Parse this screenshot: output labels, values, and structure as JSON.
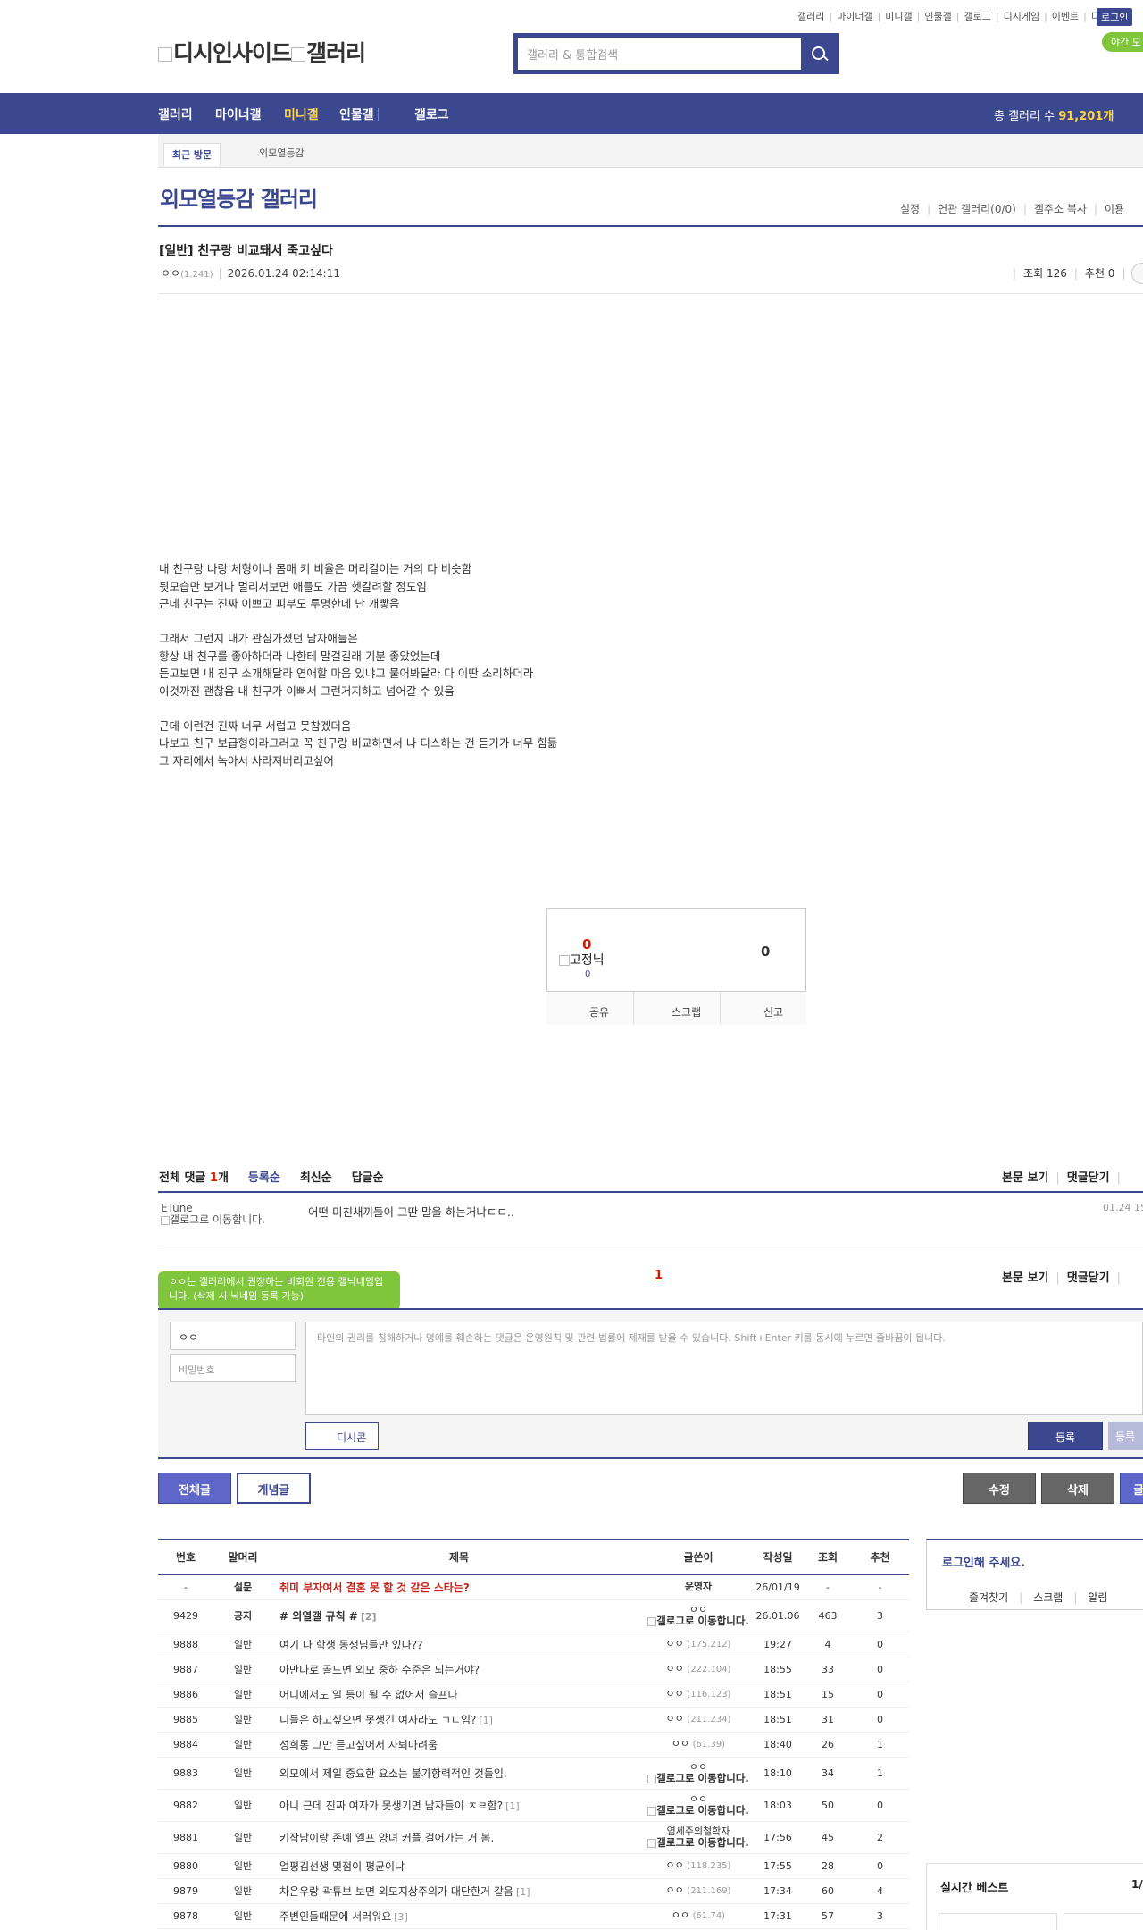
{
  "top_links": [
    "갤러리",
    "마이너갤",
    "미니갤",
    "인물갤",
    "갤로그",
    "디시게임",
    "이벤트",
    "디시콘"
  ],
  "login_label": "로그인",
  "night_mode_label": "야간 모",
  "logo_alt": [
    "디시인사이드",
    "갤러리"
  ],
  "search_placeholder": "갤러리 & 통합검색",
  "nav": [
    "갤러리",
    "마이너갤",
    "미니갤",
    "인물갤",
    "갤로그"
  ],
  "nav_active": "미니갤",
  "total_label": "총 갤러리 수 ",
  "total_count": "91,201개",
  "recent_label": "최근 방문",
  "recent_item": "외모열등감",
  "gallery_title": "외모열등감 갤러리",
  "gallery_menu": [
    "설정",
    "연관 갤러리(0/0)",
    "갤주소 복사",
    "이용"
  ],
  "post": {
    "title": "[일반] 친구랑 비교돼서 죽고싶다",
    "writer": "ㅇㅇ",
    "ip": "(1.241)",
    "date": "2026.01.24 02:14:11",
    "views": "조회 126",
    "recommend": "추천 0",
    "body": [
      "내 친구랑 나랑 체형이나 몸매 키 비율은 머리길이는 거의 다 비슷함",
      "뒷모습만 보거나 멀리서보면 애들도 가끔 헷갈려할 정도임",
      "근데 친구는 진짜 이쁘고 피부도 투명한데 난 개빻음",
      "",
      "그래서 그런지 내가 관심가졌던 남자애들은",
      "항상 내 친구를 좋아하더라 나한테 말걸길래 기분 좋았었는데",
      "듣고보면 내 친구 소개해달라 연애할 마음 있냐고 물어봐달라 다 이딴 소리하더라",
      "이것까진 괜찮음 내 친구가 이뻐서 그런거지하고 넘어갈 수 있음",
      "",
      "근데 이런건 진짜 너무 서럽고 못참겠더음",
      "나보고 친구 보급형이라그러고 꼭 친구랑 비교하면서 나 디스하는 건 듣기가 너무 힘듦",
      "그 자리에서 녹아서 사라져버리고싶어"
    ]
  },
  "vote": {
    "up": "0",
    "fix_alt": "고정닉",
    "fix_count": "0",
    "down": "0",
    "actions": [
      "공유",
      "스크랩",
      "신고"
    ]
  },
  "comments": {
    "total_prefix": "전체 댓글 ",
    "total_num": "1",
    "total_suffix": "개",
    "sort_tabs": [
      "등록순",
      "최신순",
      "답글순"
    ],
    "right_links": [
      "본문 보기",
      "댓글닫기"
    ],
    "items": [
      {
        "nick": "ETune",
        "nick_alt": "갤로그로 이동합니다.",
        "text": "어떤 미친새끼들이 그딴 말을 하는거냐ㄷㄷ..",
        "date": "01.24 15"
      }
    ],
    "page": "1"
  },
  "write": {
    "tooltip": "ㅇㅇ는 갤러리에서 권장하는 비회원 전용 갤닉네임입니다. (삭제 시 닉네임 등록 가능)",
    "nick_value": "ㅇㅇ",
    "password_placeholder": "비밀번호",
    "memo_placeholder": "타인의 권리를 침해하거나 명예를 훼손하는 댓글은 운영원칙 및 관련 법률에 제재를 받을 수 있습니다. Shift+Enter 키를 동시에 누르면 줄바꿈이 됩니다.",
    "dccon": "디시콘",
    "submit": "등록",
    "submit2": "등록"
  },
  "buttons": {
    "all": "전체글",
    "concept": "개념글",
    "edit": "수정",
    "delete": "삭제",
    "write": "글"
  },
  "list_headers": [
    "번호",
    "말머리",
    "제목",
    "글쓴이",
    "작성일",
    "조회",
    "추천"
  ],
  "list_rows": [
    {
      "no": "-",
      "head": "설문",
      "title": "취미 부자여서 결혼 못 할 것 같은 스타는?",
      "reply": "",
      "writer": "운영자",
      "ip": "",
      "gimg": false,
      "date": "26/01/19",
      "views": "-",
      "rec": "-",
      "type": "survey"
    },
    {
      "no": "9429",
      "head": "공지",
      "title": "# 외열갤 규칙 #",
      "reply": "[2]",
      "writer": "ㅇㅇ",
      "ip": "",
      "gimg": true,
      "date": "26.01.06",
      "views": "463",
      "rec": "3",
      "type": "notice"
    },
    {
      "no": "9888",
      "head": "일반",
      "title": "여기 다 학생 동생님들만 있나??",
      "reply": "",
      "writer": "ㅇㅇ",
      "ip": "(175.212)",
      "gimg": false,
      "date": "19:27",
      "views": "4",
      "rec": "0",
      "type": "normal"
    },
    {
      "no": "9887",
      "head": "일반",
      "title": "아만다로 골드면 외모 중하 수준은 되는거야?",
      "reply": "",
      "writer": "ㅇㅇ",
      "ip": "(222.104)",
      "gimg": false,
      "date": "18:55",
      "views": "33",
      "rec": "0",
      "type": "normal"
    },
    {
      "no": "9886",
      "head": "일반",
      "title": "어디에서도 일 등이 될 수 없어서 슬프다",
      "reply": "",
      "writer": "ㅇㅇ",
      "ip": "(116.123)",
      "gimg": false,
      "date": "18:51",
      "views": "15",
      "rec": "0",
      "type": "normal"
    },
    {
      "no": "9885",
      "head": "일반",
      "title": "니들은 하고싶으면 못생긴 여자라도 ㄱㄴ임?",
      "reply": "[1]",
      "writer": "ㅇㅇ",
      "ip": "(211.234)",
      "gimg": false,
      "date": "18:51",
      "views": "31",
      "rec": "0",
      "type": "normal"
    },
    {
      "no": "9884",
      "head": "일반",
      "title": "성희롱 그만 듣고싶어서 자퇴마려움",
      "reply": "",
      "writer": "ㅇㅇ",
      "ip": "(61.39)",
      "gimg": false,
      "date": "18:40",
      "views": "26",
      "rec": "1",
      "type": "normal"
    },
    {
      "no": "9883",
      "head": "일반",
      "title": "외모에서 제일 중요한 요소는 불가항력적인 것들임.",
      "reply": "",
      "writer": "ㅇㅇ",
      "ip": "",
      "gimg": true,
      "date": "18:10",
      "views": "34",
      "rec": "1",
      "type": "normal"
    },
    {
      "no": "9882",
      "head": "일반",
      "title": "아니 근데 진짜 여자가 못생기면 남자들이 ㅈㄹ함?",
      "reply": "[1]",
      "writer": "ㅇㅇ",
      "ip": "",
      "gimg": true,
      "date": "18:03",
      "views": "50",
      "rec": "0",
      "type": "normal"
    },
    {
      "no": "9881",
      "head": "일반",
      "title": "키작남이랑 존예 엘프 양녀 커플 걸어가는 거 봄.",
      "reply": "",
      "writer": "염세주의철학자",
      "ip": "",
      "gimg": true,
      "date": "17:56",
      "views": "45",
      "rec": "2",
      "type": "normal"
    },
    {
      "no": "9880",
      "head": "일반",
      "title": "얼평김선생 몇점이 평균이냐",
      "reply": "",
      "writer": "ㅇㅇ",
      "ip": "(118.235)",
      "gimg": false,
      "date": "17:55",
      "views": "28",
      "rec": "0",
      "type": "normal"
    },
    {
      "no": "9879",
      "head": "일반",
      "title": "차은우랑 곽튜브 보면 외모지상주의가 대단한거 같음",
      "reply": "[1]",
      "writer": "ㅇㅇ",
      "ip": "(211.169)",
      "gimg": false,
      "date": "17:34",
      "views": "60",
      "rec": "4",
      "type": "normal"
    },
    {
      "no": "9878",
      "head": "일반",
      "title": "주변인들때문에 서러워요",
      "reply": "[3]",
      "writer": "ㅇㅇ",
      "ip": "(61.74)",
      "gimg": false,
      "date": "17:31",
      "views": "57",
      "rec": "3",
      "type": "normal"
    }
  ],
  "gallog_alt": "갤로그로 이동합니다.",
  "sidebar": {
    "login_title": "로그인해 주세요.",
    "login_tabs": [
      "즐겨찾기",
      "스크랩",
      "알림"
    ],
    "best_title": "실시간 베스트",
    "best_page": "1/"
  }
}
